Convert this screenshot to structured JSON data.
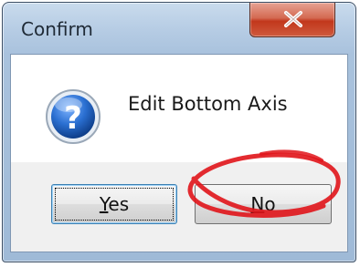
{
  "window": {
    "title": "Confirm"
  },
  "dialog": {
    "message": "Edit Bottom Axis",
    "icon": "question-icon"
  },
  "buttons": {
    "yes": {
      "mnemonic": "Y",
      "rest": "es"
    },
    "no": {
      "mnemonic": "N",
      "rest": "o"
    }
  },
  "icons": {
    "close": "close-icon",
    "question": "question-icon"
  },
  "colors": {
    "close_button": "#c2371c",
    "question_icon": "#1d5fbf",
    "annotation": "#e0141a"
  },
  "annotation": {
    "type": "red-circle",
    "target": "no-button"
  }
}
